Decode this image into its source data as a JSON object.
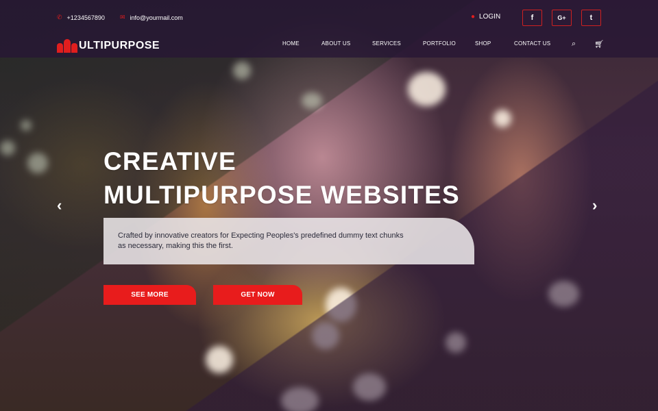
{
  "topbar": {
    "phone": "+1234567890",
    "email": "info@yourmail.com",
    "login": "LOGIN",
    "social": [
      {
        "icon": "facebook-icon",
        "glyph": "f"
      },
      {
        "icon": "google-plus-icon",
        "glyph": "G+"
      },
      {
        "icon": "twitter-icon",
        "glyph": "t"
      }
    ]
  },
  "nav": {
    "logo_text": "ULTIPURPOSE",
    "items": [
      "HOME",
      "ABOUT US",
      "SERVICES",
      "PORTFOLIO",
      "SHOP",
      "CONTACT US"
    ],
    "icons": [
      "search-icon",
      "cart-icon"
    ]
  },
  "hero": {
    "headline_line1": "CREATIVE",
    "headline_line2": "MULTIPURPOSE WEBSITES",
    "subtitle": "Crafted by innovative creators for Expecting Peoples's predefined dummy text chunks as necessary, making this the first.",
    "buttons": {
      "see_more": "SEE MORE",
      "get_now": "GET NOW"
    },
    "arrows": {
      "prev": "‹",
      "next": "›"
    }
  },
  "colors": {
    "accent": "#e81c1c",
    "header": "#261634"
  }
}
